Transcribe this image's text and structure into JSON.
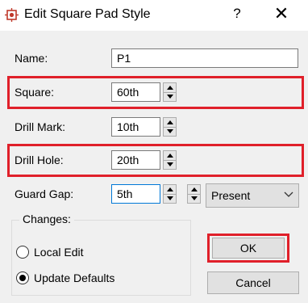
{
  "title": "Edit Square Pad Style",
  "title_buttons": {
    "help": "?",
    "close": "✕"
  },
  "fields": {
    "name": {
      "label": "Name:",
      "value": "P1"
    },
    "square": {
      "label": "Square:",
      "value": "60th"
    },
    "drill_mark": {
      "label": "Drill Mark:",
      "value": "10th"
    },
    "drill_hole": {
      "label": "Drill Hole:",
      "value": "20th"
    },
    "guard_gap": {
      "label": "Guard Gap:",
      "value": "5th"
    }
  },
  "guard_select": {
    "value": "Present"
  },
  "changes": {
    "label": "Changes:",
    "options": [
      {
        "label": "Local Edit",
        "selected": false
      },
      {
        "label": "Update Defaults",
        "selected": true
      }
    ]
  },
  "buttons": {
    "ok": "OK",
    "cancel": "Cancel"
  },
  "colors": {
    "highlight": "#e0202a",
    "dialog_bg": "#f0f0f0"
  },
  "icons": {
    "app": "pad-icon",
    "spinner_up": "triangle-up",
    "spinner_down": "triangle-down",
    "dropdown": "chevron-down"
  }
}
